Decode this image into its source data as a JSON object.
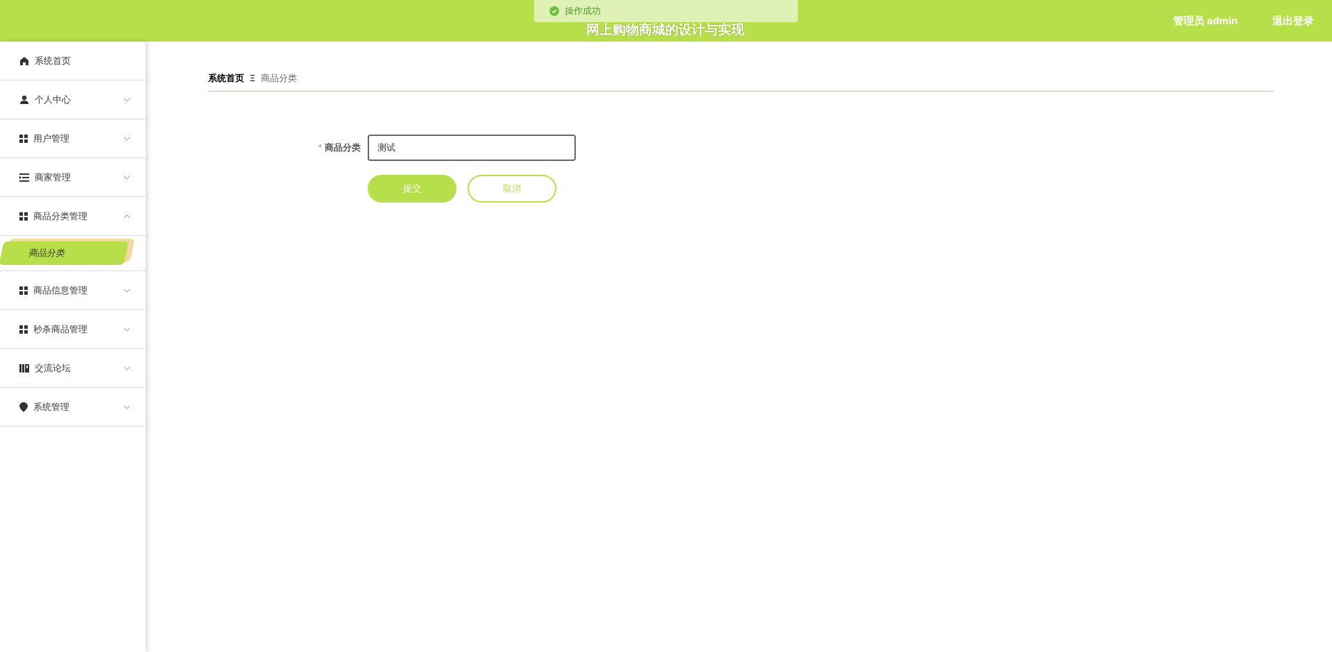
{
  "header": {
    "title": "网上购物商城的设计与实现",
    "user": "管理员 admin",
    "logout": "退出登录"
  },
  "toast": {
    "message": "操作成功"
  },
  "sidebar": {
    "items": [
      {
        "label": "系统首页",
        "kind": "home"
      },
      {
        "label": "个人中心",
        "kind": "user",
        "expanded": false
      },
      {
        "label": "用户管理",
        "kind": "grid",
        "expanded": false
      },
      {
        "label": "商家管理",
        "kind": "list",
        "expanded": false
      },
      {
        "label": "商品分类管理",
        "kind": "grid",
        "expanded": true,
        "children": [
          {
            "label": "商品分类",
            "selected": true
          }
        ]
      },
      {
        "label": "商品信息管理",
        "kind": "grid",
        "expanded": false
      },
      {
        "label": "秒杀商品管理",
        "kind": "grid",
        "expanded": false
      },
      {
        "label": "交流论坛",
        "kind": "book",
        "expanded": false
      },
      {
        "label": "系统管理",
        "kind": "pin",
        "expanded": false
      }
    ]
  },
  "breadcrumb": {
    "home": "系统首页",
    "separator": "Ξ",
    "current": "商品分类"
  },
  "form": {
    "label": "商品分类",
    "required": "*",
    "value": "测试",
    "submit": "提交",
    "cancel": "取消"
  }
}
